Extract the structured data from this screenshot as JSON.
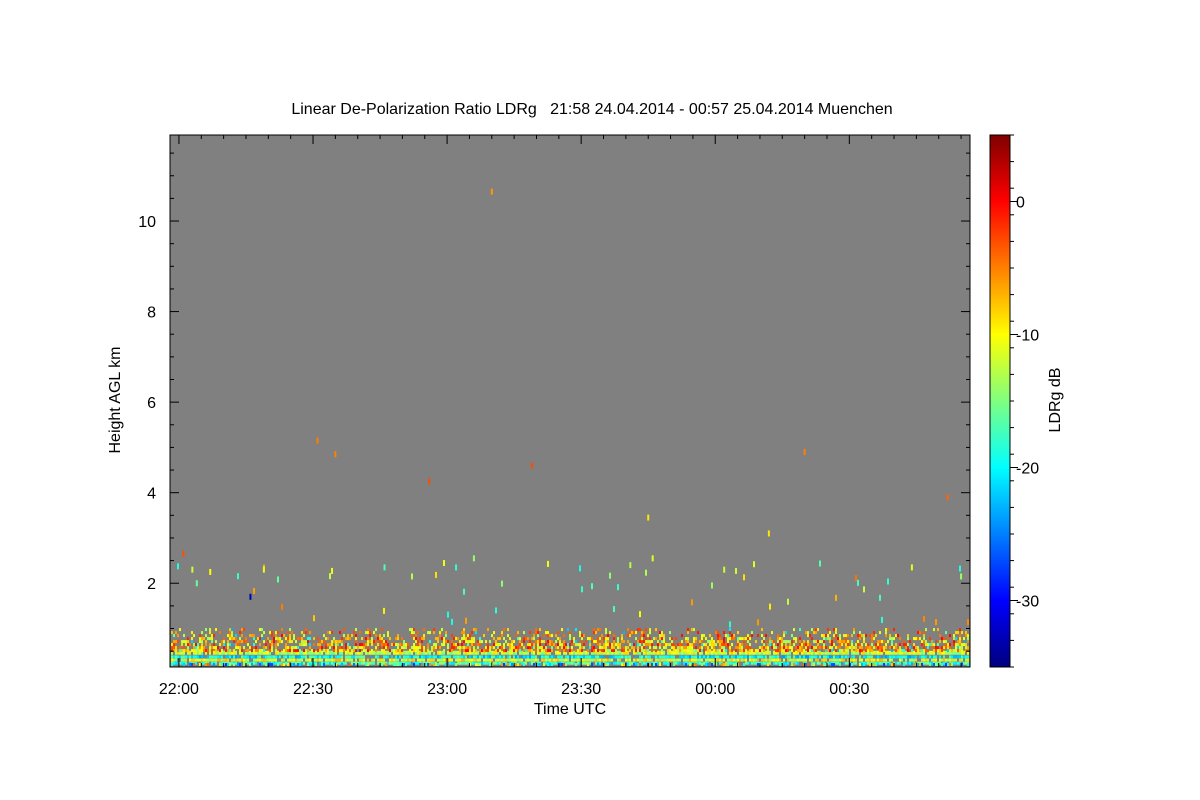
{
  "chart_data": {
    "type": "heatmap",
    "title": "Linear De-Polarization Ratio LDRg   21:58 24.04.2014 - 00:57 25.04.2014 Muenchen",
    "xlabel": "Time UTC",
    "ylabel": "Height AGL km",
    "x_range": [
      "21:58",
      "00:57"
    ],
    "x_tick_labels": [
      "22:00",
      "22:30",
      "23:00",
      "23:30",
      "00:00",
      "00:30"
    ],
    "ylim": [
      0.15,
      11.9
    ],
    "y_tick_labels": [
      "2",
      "4",
      "6",
      "8",
      "10"
    ],
    "y_ticks": [
      2,
      4,
      6,
      8,
      10
    ],
    "background_color": "#808080",
    "colorbar": {
      "label": "LDRg dB",
      "range": [
        -35,
        5
      ],
      "tick_values": [
        -30,
        -20,
        -10,
        0
      ],
      "tick_labels": [
        "-30",
        "-20",
        "-10",
        "0"
      ],
      "colormap": "jet"
    },
    "sparse_points": [
      {
        "time": "22:01",
        "height_km": 2.65,
        "ldr_db": -3
      },
      {
        "time": "22:03",
        "height_km": 2.3,
        "ldr_db": -12
      },
      {
        "time": "22:04",
        "height_km": 2.0,
        "ldr_db": -16
      },
      {
        "time": "22:07",
        "height_km": 2.25,
        "ldr_db": -10
      },
      {
        "time": "22:16",
        "height_km": 1.7,
        "ldr_db": -33
      },
      {
        "time": "22:19",
        "height_km": 2.3,
        "ldr_db": -11
      },
      {
        "time": "22:31",
        "height_km": 5.15,
        "ldr_db": -5
      },
      {
        "time": "22:35",
        "height_km": 4.85,
        "ldr_db": -5
      },
      {
        "time": "22:46",
        "height_km": 2.35,
        "ldr_db": -17
      },
      {
        "time": "22:56",
        "height_km": 4.25,
        "ldr_db": -3
      },
      {
        "time": "23:02",
        "height_km": 2.35,
        "ldr_db": -18
      },
      {
        "time": "23:06",
        "height_km": 2.55,
        "ldr_db": -14
      },
      {
        "time": "23:10",
        "height_km": 10.65,
        "ldr_db": -6
      },
      {
        "time": "23:19",
        "height_km": 4.6,
        "ldr_db": -3
      },
      {
        "time": "23:41",
        "height_km": 2.4,
        "ldr_db": -13
      },
      {
        "time": "23:45",
        "height_km": 3.45,
        "ldr_db": -9
      },
      {
        "time": "23:46",
        "height_km": 2.55,
        "ldr_db": -11
      },
      {
        "time": "00:02",
        "height_km": 2.3,
        "ldr_db": -12
      },
      {
        "time": "00:12",
        "height_km": 3.1,
        "ldr_db": -9
      },
      {
        "time": "00:20",
        "height_km": 4.9,
        "ldr_db": -5
      },
      {
        "time": "00:44",
        "height_km": 2.35,
        "ldr_db": -11
      },
      {
        "time": "00:52",
        "height_km": 3.9,
        "ldr_db": -4
      },
      {
        "time": "00:55",
        "height_km": 2.15,
        "ldr_db": -14
      }
    ],
    "dense_layer": {
      "height_km": [
        0.15,
        1.0
      ],
      "ldr_db_range": [
        -25,
        0
      ]
    }
  }
}
